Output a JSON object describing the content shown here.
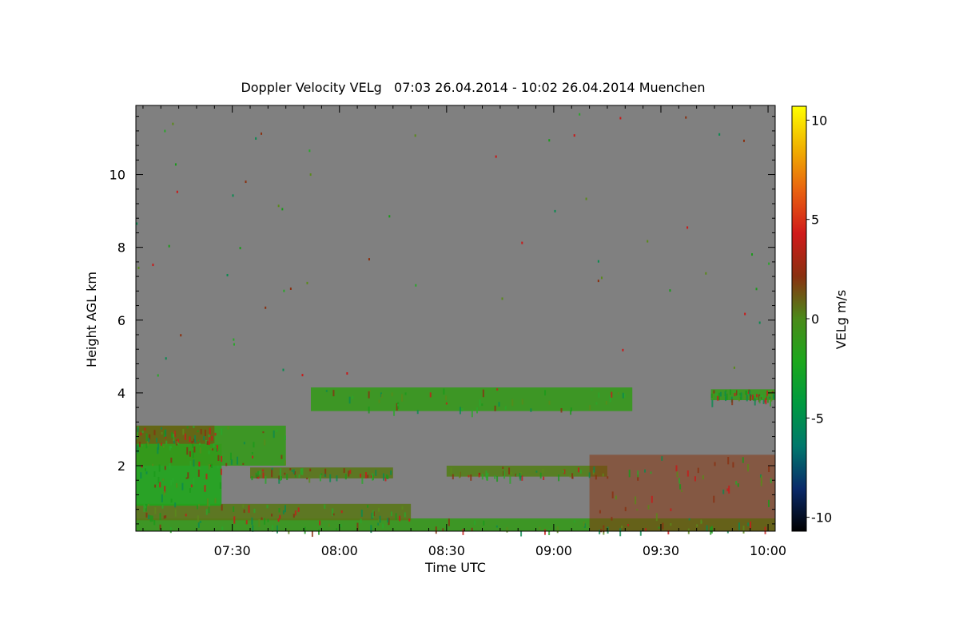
{
  "chart_data": {
    "type": "heatmap",
    "title": "Doppler Velocity VELg   07:03 26.04.2014 - 10:02 26.04.2014 Muenchen",
    "xlabel": "Time UTC",
    "ylabel": "Height AGL km",
    "xlim": [
      "07:03",
      "10:02"
    ],
    "ylim": [
      0.2,
      11.9
    ],
    "x_ticks": [
      "07:30",
      "08:00",
      "08:30",
      "09:00",
      "09:30",
      "10:00"
    ],
    "y_ticks": [
      "2",
      "4",
      "6",
      "8",
      "10"
    ],
    "grid": false,
    "background_color": "#808080",
    "colorbar": {
      "label": "VELg m/s",
      "range": [
        -10.7,
        10.7
      ],
      "ticks": [
        "10",
        "5",
        "0",
        "-5",
        "-10"
      ],
      "colors": [
        "#000000",
        "#0a2a6a",
        "#00786c",
        "#009a40",
        "#1ca71c",
        "#4a8a1a",
        "#8a3010",
        "#d01a1a",
        "#e86010",
        "#f0b000",
        "#ffff00"
      ]
    },
    "regions": [
      {
        "t0": "07:03",
        "t1": "10:02",
        "h0": 0.2,
        "h1": 0.55,
        "velocity": -1,
        "description": "near-surface band"
      },
      {
        "t0": "07:03",
        "t1": "08:20",
        "h0": 0.5,
        "h1": 0.95,
        "velocity": 0.5
      },
      {
        "t0": "07:03",
        "t1": "07:27",
        "h0": 0.9,
        "h1": 2.6,
        "velocity": -2
      },
      {
        "t0": "07:03",
        "t1": "07:45",
        "h0": 2.0,
        "h1": 3.1,
        "velocity": -1
      },
      {
        "t0": "07:03",
        "t1": "07:25",
        "h0": 2.6,
        "h1": 3.1,
        "velocity": 1
      },
      {
        "t0": "07:35",
        "t1": "08:15",
        "h0": 1.65,
        "h1": 1.95,
        "velocity": 0.5
      },
      {
        "t0": "08:30",
        "t1": "09:15",
        "h0": 1.7,
        "h1": 2.0,
        "velocity": 0.3
      },
      {
        "t0": "07:52",
        "t1": "09:22",
        "h0": 3.5,
        "h1": 4.15,
        "velocity": -1
      },
      {
        "t0": "09:44",
        "t1": "10:02",
        "h0": 3.8,
        "h1": 4.1,
        "velocity": -1
      },
      {
        "t0": "09:10",
        "t1": "10:02",
        "h0": 0.2,
        "h1": 2.3,
        "velocity": 2,
        "description": "red convective speckle"
      }
    ]
  }
}
